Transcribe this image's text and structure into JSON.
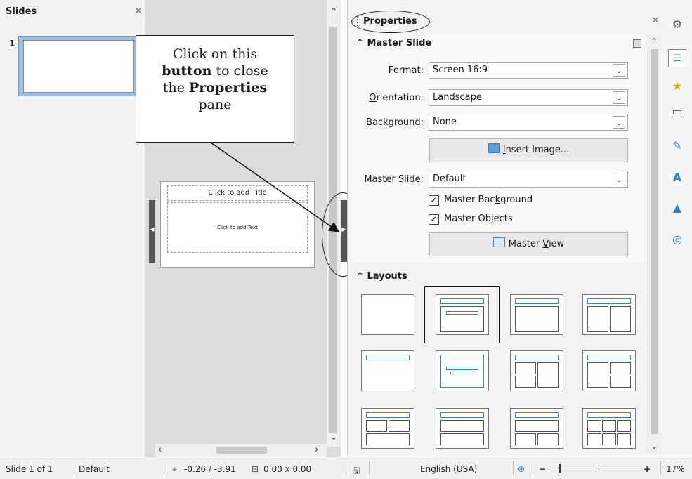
{
  "slides_pane": {
    "title": "Slides",
    "close_glyph": "×",
    "thumbnail_number": "1"
  },
  "slide": {
    "title_placeholder": "Click to add Title",
    "text_placeholder": "Click to add Text"
  },
  "callout": {
    "line1": "Click on this",
    "bold1": "button",
    "line2": " to close",
    "line3_pre": "the ",
    "bold2": "Properties",
    "line4": "pane"
  },
  "properties": {
    "title": "Properties",
    "close_glyph": "×",
    "master_slide_section": "Master Slide",
    "format_label_u": "F",
    "format_label_rest": "ormat:",
    "format_value": "Screen 16:9",
    "orientation_label_u": "O",
    "orientation_label_rest": "rientation:",
    "orientation_value": "Landscape",
    "background_label_u": "B",
    "background_label_rest": "ackground:",
    "background_value": "None",
    "insert_image_u": "I",
    "insert_image_rest": "nsert Image...",
    "master_slide_label": "Master Slide:",
    "master_slide_value": "Default",
    "master_background_pre": "Master Bac",
    "master_background_u": "k",
    "master_background_post": "ground",
    "master_objects_pre": "Master Ob",
    "master_objects_u": "j",
    "master_objects_post": "ects",
    "master_view_pre": "Master ",
    "master_view_u": "V",
    "master_view_post": "iew",
    "layouts_section": "Layouts"
  },
  "sidebar_tabs": [
    "settings-icon",
    "properties-icon",
    "slide-transition-icon",
    "animation-icon",
    "master-slides-icon",
    "styles-icon",
    "gallery-icon",
    "navigator-icon"
  ],
  "statusbar": {
    "slide_position": "Slide 1 of 1",
    "master_name": "Default",
    "cursor_position": "-0.26 / -3.91",
    "object_size": "0.00 x 0.00",
    "language": "English (USA)",
    "zoom": "17%"
  },
  "colors": {
    "selection": "#9bbfe3",
    "layout_line": "#3a83c4"
  }
}
